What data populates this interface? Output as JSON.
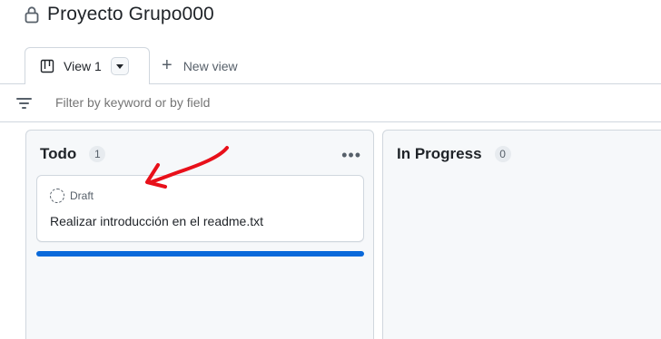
{
  "project": {
    "title": "Proyecto Grupo000",
    "icon": "lock-icon"
  },
  "tabs": {
    "active_label": "View 1",
    "new_view_label": "New view"
  },
  "filter": {
    "placeholder": "Filter by keyword or by field"
  },
  "columns": [
    {
      "title": "Todo",
      "count": "1",
      "cards": [
        {
          "status": "Draft",
          "title": "Realizar introducción en el readme.txt"
        }
      ]
    },
    {
      "title": "In Progress",
      "count": "0",
      "cards": []
    }
  ],
  "colors": {
    "accent": "#0969da",
    "annotation": "#e8101a",
    "column_bg": "#f6f8fa",
    "border": "#d0d7de"
  }
}
